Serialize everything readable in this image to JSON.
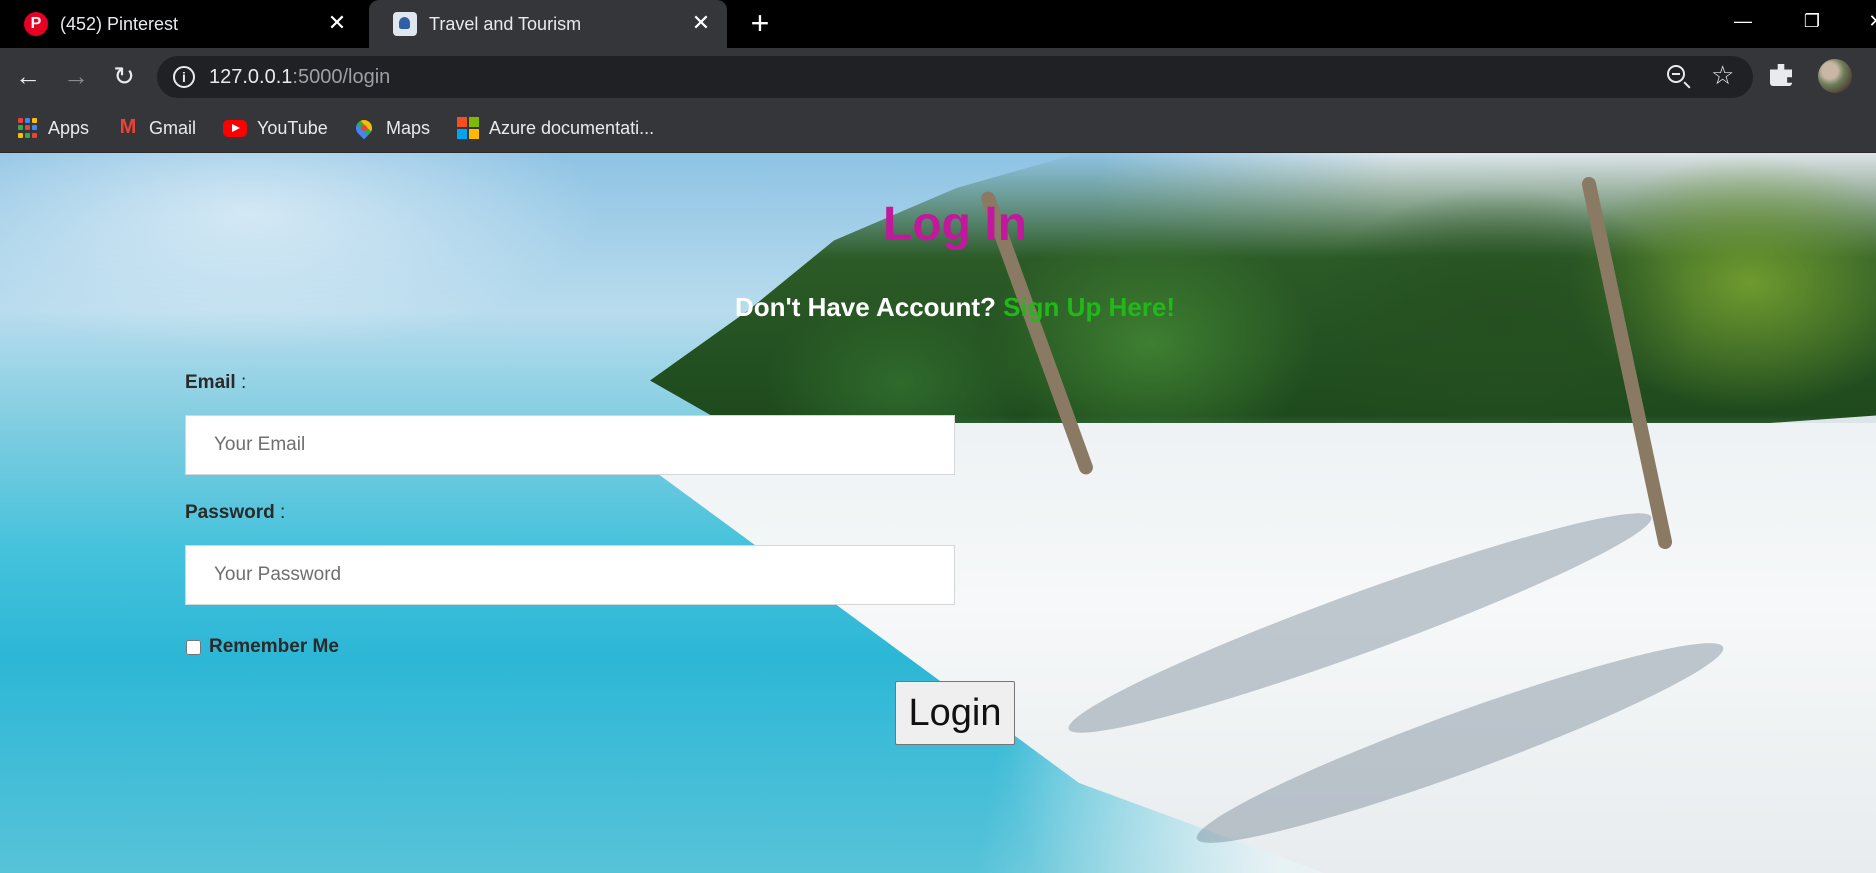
{
  "browser": {
    "tabs": [
      {
        "title": "(452) Pinterest",
        "favicon": "pinterest-icon",
        "active": false
      },
      {
        "title": "Travel and Tourism",
        "favicon": "travel-site-icon",
        "active": true
      }
    ],
    "new_tab_icon": "plus-icon",
    "window_controls": {
      "minimize": "—",
      "restore": "❐",
      "close": "✕"
    },
    "url_host": "127.0.0.1",
    "url_path": ":5000/login",
    "nav_icons": {
      "back": "←",
      "forward": "→",
      "reload": "↻",
      "star": "☆"
    }
  },
  "bookmarks": [
    {
      "label": "Apps",
      "icon": "apps-grid-icon"
    },
    {
      "label": "Gmail",
      "icon": "gmail-icon"
    },
    {
      "label": "YouTube",
      "icon": "youtube-icon"
    },
    {
      "label": "Maps",
      "icon": "maps-icon"
    },
    {
      "label": "Azure documentati...",
      "icon": "microsoft-icon"
    }
  ],
  "login": {
    "title": "Log In",
    "no_account_text": "Don't Have Account?",
    "signup_link": "Sign Up Here!",
    "email_label": "Email",
    "email_placeholder": "Your Email",
    "password_label": "Password",
    "password_placeholder": "Your Password",
    "label_suffix": " :",
    "remember_label": "Remember Me",
    "remember_checked": false,
    "submit_label": "Login"
  },
  "colors": {
    "title": "#c2189b",
    "signup_link": "#22b81b",
    "chrome_dark": "#35363a",
    "tab_strip": "#000000"
  }
}
